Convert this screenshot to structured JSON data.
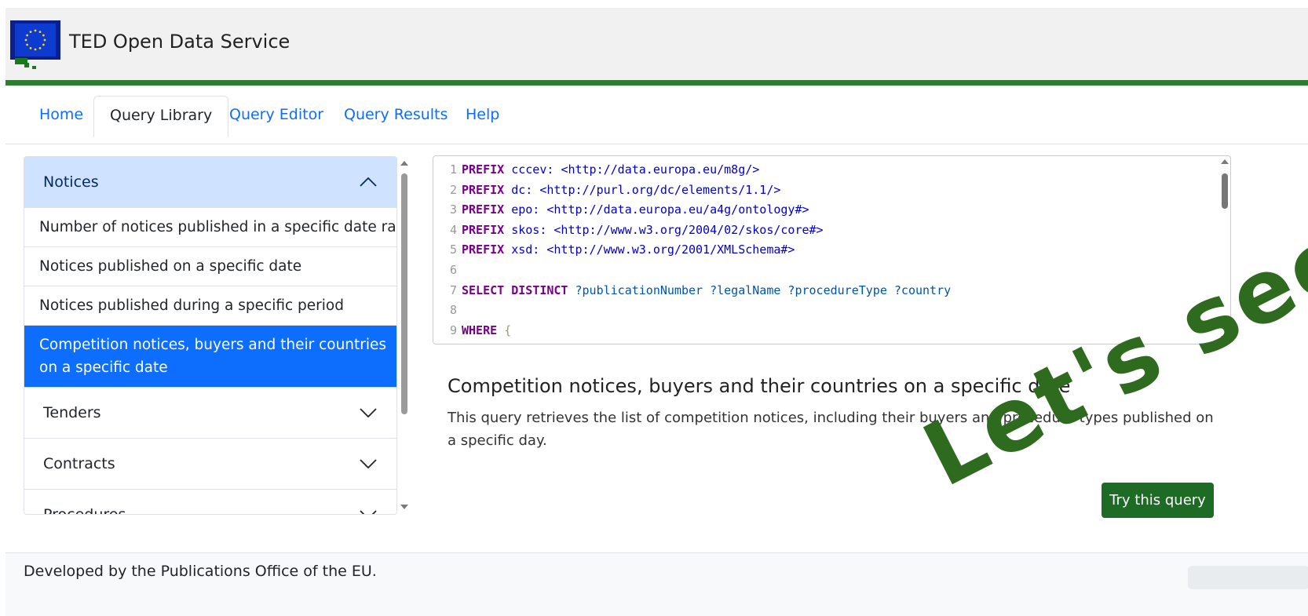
{
  "header": {
    "title": "TED Open Data Service",
    "accent": "#2e7d32"
  },
  "tabs": [
    {
      "label": "Home",
      "active": false
    },
    {
      "label": "Query Library",
      "active": true
    },
    {
      "label": "Query Editor",
      "active": false
    },
    {
      "label": "Query Results",
      "active": false
    },
    {
      "label": "Help",
      "active": false
    }
  ],
  "sidebar": {
    "sections": [
      {
        "label": "Notices",
        "expanded": true,
        "icon": "chevron-up-icon"
      },
      {
        "label": "Tenders",
        "expanded": false,
        "icon": "chevron-down-icon"
      },
      {
        "label": "Contracts",
        "expanded": false,
        "icon": "chevron-down-icon"
      },
      {
        "label": "Procedures",
        "expanded": false,
        "icon": "chevron-down-icon"
      }
    ],
    "queries": [
      {
        "label": "Number of notices published in a specific date range",
        "active": false
      },
      {
        "label": "Notices published on a specific date",
        "active": false
      },
      {
        "label": "Notices published during a specific period",
        "active": false
      },
      {
        "label": "Competition notices, buyers and their countries on a specific date",
        "active": true
      }
    ]
  },
  "editor": {
    "line_numbers": [
      "1",
      "2",
      "3",
      "4",
      "5",
      "6",
      "7",
      "8",
      "9"
    ],
    "lines": [
      {
        "kw": "PREFIX",
        "prefix": "cccev:",
        "uri": "<http://data.europa.eu/m8g/>"
      },
      {
        "kw": "PREFIX",
        "prefix": "dc:",
        "uri": "<http://purl.org/dc/elements/1.1/>"
      },
      {
        "kw": "PREFIX",
        "prefix": "epo:",
        "uri": "<http://data.europa.eu/a4g/ontology#>"
      },
      {
        "kw": "PREFIX",
        "prefix": "skos:",
        "uri": "<http://www.w3.org/2004/02/skos/core#>"
      },
      {
        "kw": "PREFIX",
        "prefix": "xsd:",
        "uri": "<http://www.w3.org/2001/XMLSchema#>"
      }
    ],
    "select_kw": "SELECT DISTINCT",
    "select_vars": "?publicationNumber ?legalName ?procedureType ?country",
    "where_kw": "WHERE",
    "where_brace": "{"
  },
  "description": {
    "title": "Competition notices, buyers and their countries on a specific date",
    "text": "This query retrieves the list of competition notices, including their buyers and procedure types published on a specific day."
  },
  "try_button": {
    "label": "Try this query",
    "color": "#1e6b26"
  },
  "watermark": "Let's see",
  "footer": {
    "text": "Developed by the Publications Office of the EU."
  }
}
